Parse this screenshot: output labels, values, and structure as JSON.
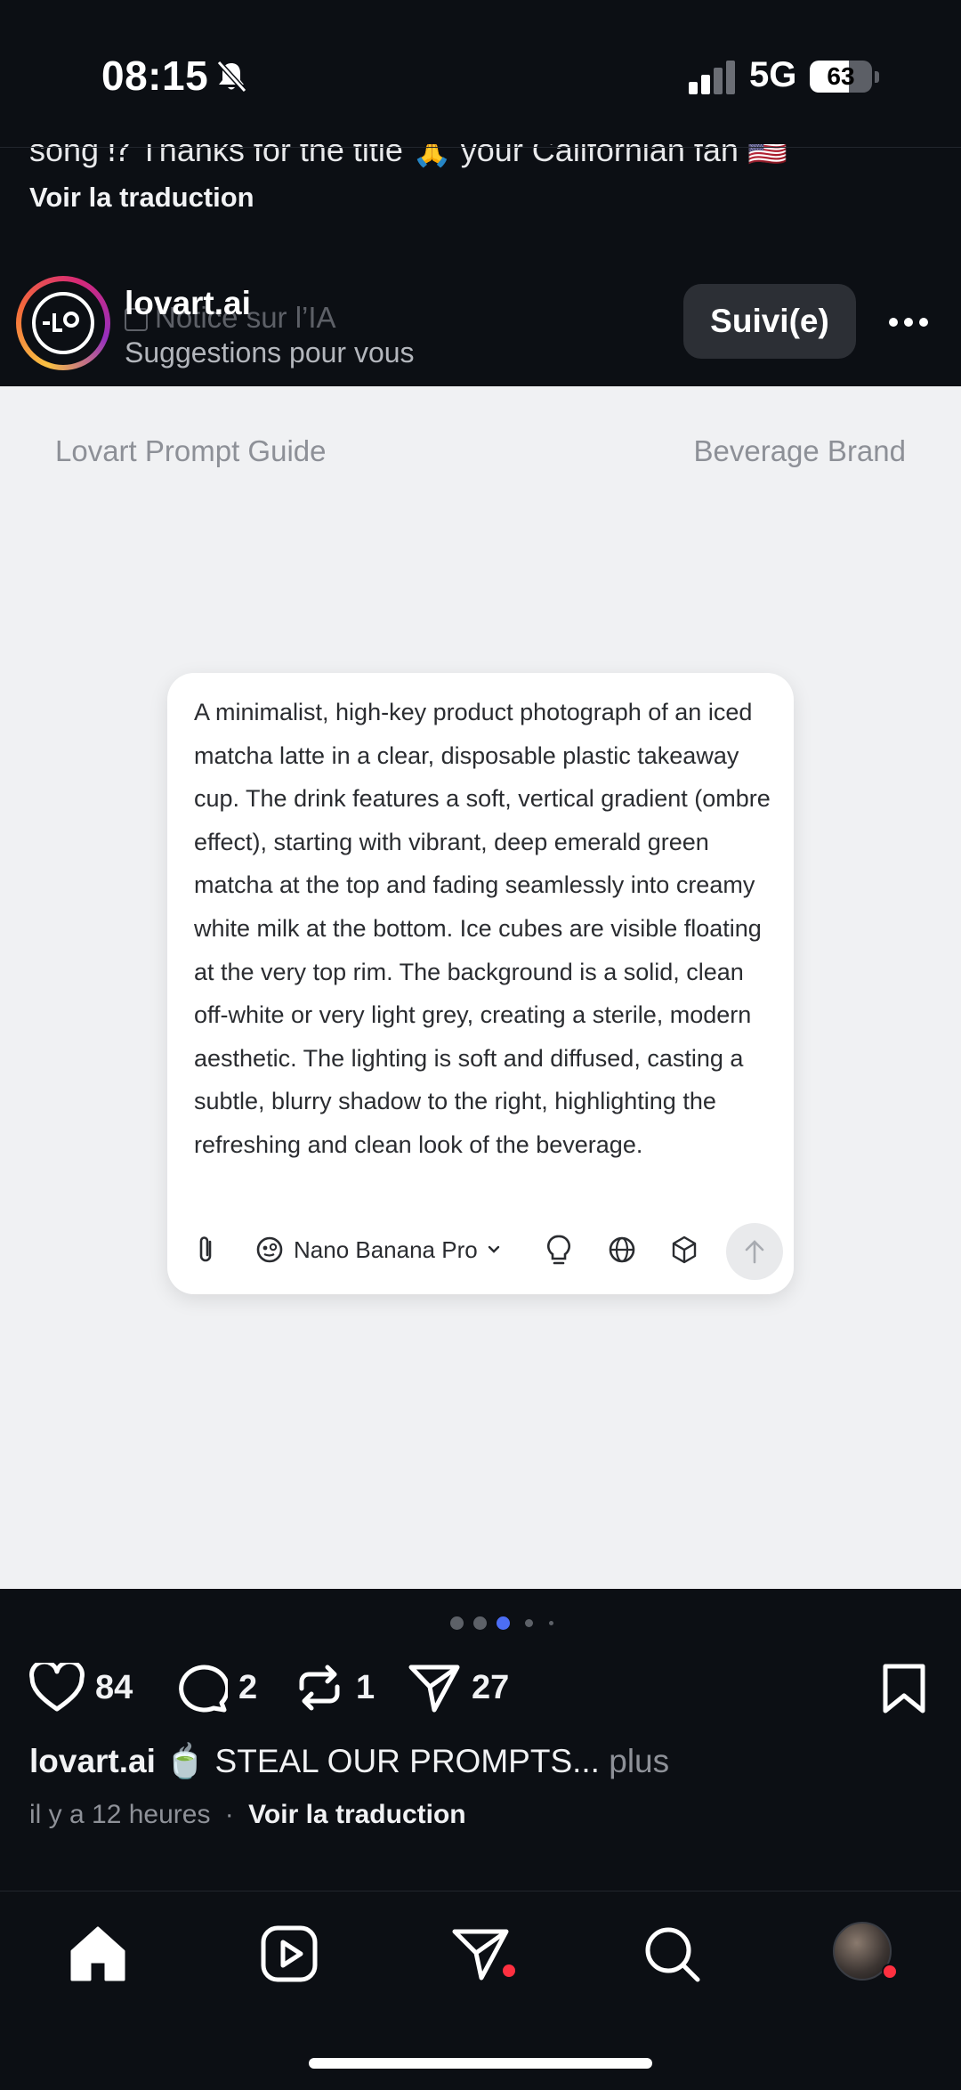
{
  "status_bar": {
    "time": "08:15",
    "network": "5G",
    "battery": "63",
    "battery_level": 0.63
  },
  "previous_post": {
    "caption_fragment": "song ⁉ Thanks for the title 🙏 your Californian fan 🇺🇸",
    "translate_link": "Voir la traduction"
  },
  "post_header": {
    "username": "lovart.ai",
    "ai_notice": "Notice sur l’IA",
    "subtitle": "Suggestions pour vous",
    "follow_label": "Suivi(e)"
  },
  "post_image": {
    "header_left": "Lovart Prompt Guide",
    "header_right": "Beverage Brand",
    "prompt_text": "A minimalist, high-key product photograph of an iced matcha latte in a clear, disposable plastic takeaway cup. The drink features a soft, vertical gradient (ombre effect), starting with vibrant, deep emerald green matcha at the top and fading seamlessly into creamy white milk at the bottom. Ice cubes are visible floating at the very top rim. The background is a solid, clean off-white or very light grey, creating a sterile, modern aesthetic. The lighting is soft and diffused, casting a subtle, blurry shadow to the right, highlighting the refreshing and clean look of the beverage.",
    "model_label": "Nano Banana Pro",
    "toolbar_icons": [
      "paperclip-icon",
      "model-face-icon",
      "chevron-down-icon",
      "lightbulb-icon",
      "globe-icon",
      "cube-icon",
      "arrow-up-icon"
    ]
  },
  "carousel": {
    "total_visible_dots": 5,
    "active_index": 2,
    "active_color": "#4c6ef5"
  },
  "actions": {
    "likes": "84",
    "comments": "2",
    "reposts": "1",
    "shares": "27"
  },
  "caption": {
    "username": "lovart.ai",
    "text": "🍵 STEAL OUR PROMPTS...",
    "more_label": "plus"
  },
  "meta": {
    "time_ago": "il y a 12 heures",
    "separator": "·",
    "translate_link": "Voir la traduction"
  },
  "bottom_nav": {
    "items": [
      "home-icon",
      "reels-icon",
      "direct-icon",
      "search-icon",
      "profile-avatar"
    ],
    "notification_color": "#ff3040"
  }
}
